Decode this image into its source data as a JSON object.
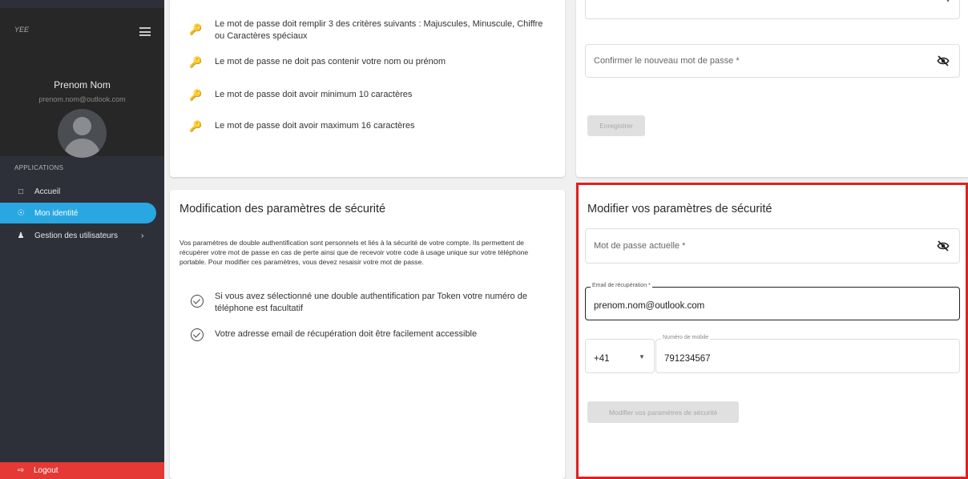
{
  "sidebar": {
    "logo_text": "YEE",
    "user_name": "Prenom Nom",
    "user_email": "prenom.nom@outlook.com",
    "section_label": "APPLICATIONS",
    "items": [
      {
        "label": "Accueil",
        "icon": "chat-icon"
      },
      {
        "label": "Mon identité",
        "icon": "shield-icon"
      },
      {
        "label": "Gestion des utilisateurs",
        "icon": "users-icon"
      }
    ],
    "logout_label": "Logout"
  },
  "password_rules": [
    "Le mot de passe doit remplir 3 des critères suivants : Majuscules, Minuscule, Chiffre ou Caractères spéciaux",
    "Le mot de passe ne doit pas contenir votre nom ou prénom",
    "Le mot de passe doit avoir minimum 10 caractères",
    "Le mot de passe doit avoir maximum 16 caractères"
  ],
  "password_form": {
    "confirm_placeholder": "Confirmer le nouveau mot de passe *",
    "save_label": "Enregistrer"
  },
  "security_info": {
    "title": "Modification des paramètres de sécurité",
    "description": "Vos paramètres de double authentification sont personnels et liés à la sécurité de votre compte. Ils permettent de récupérer votre mot de passe en cas de perte ainsi que de recevoir votre code à usage unique sur votre téléphone portable. Pour modifier ces paramètres, vous devez resaisir votre mot de passe.",
    "notes": [
      "Si vous avez sélectionné une double authentification par Token votre numéro de téléphone est facultatif",
      "Votre adresse email de récupération doit être facilement accessible"
    ]
  },
  "security_form": {
    "title": "Modifier vos paramètres de sécurité",
    "current_password_placeholder": "Mot de passe actuelle *",
    "recovery_email_label": "Email de récupération *",
    "recovery_email_value": "prenom.nom@outlook.com",
    "country_code": "+41",
    "mobile_label": "Numéro de mobile",
    "mobile_value": "791234567",
    "submit_label": "Modifier vos paramètres de sécurité"
  },
  "colors": {
    "active_nav": "#29a7e1",
    "logout": "#e53935",
    "highlight_border": "#e02020"
  }
}
